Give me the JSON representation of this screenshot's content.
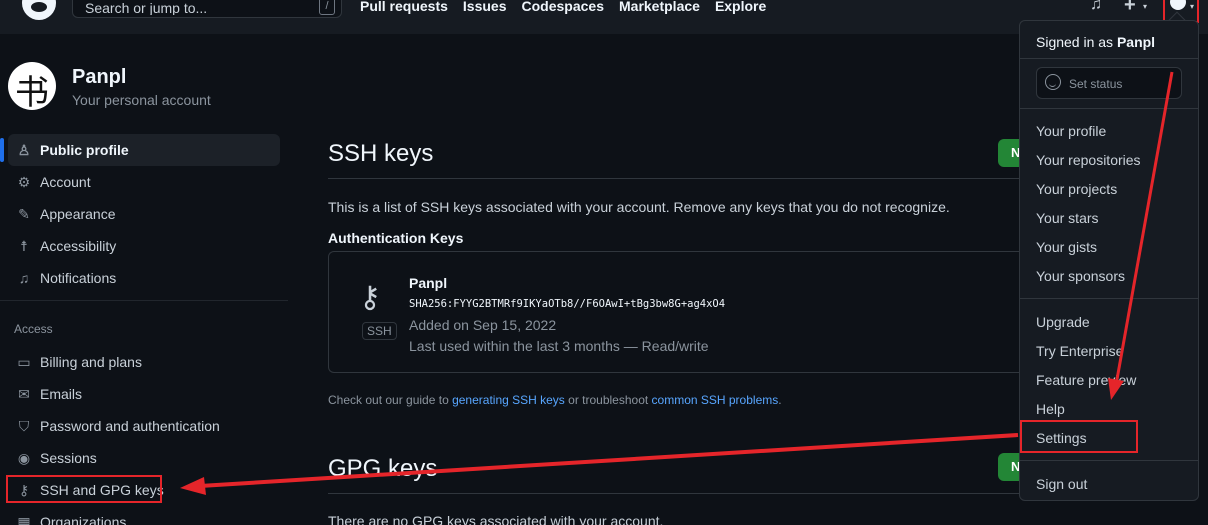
{
  "header": {
    "search_placeholder": "Search or jump to...",
    "search_key": "/",
    "nav": [
      "Pull requests",
      "Issues",
      "Codespaces",
      "Marketplace",
      "Explore"
    ],
    "plus": "+",
    "caret": "▾"
  },
  "profile": {
    "name": "Panpl",
    "subtitle": "Your personal account",
    "avatar_glyph": "书"
  },
  "sidebar": {
    "items": [
      {
        "label": "Public profile",
        "icon": "person-icon",
        "glyph": "♙",
        "active": true
      },
      {
        "label": "Account",
        "icon": "gear-icon",
        "glyph": "⚙"
      },
      {
        "label": "Appearance",
        "icon": "paintbrush-icon",
        "glyph": "✎"
      },
      {
        "label": "Accessibility",
        "icon": "accessibility-icon",
        "glyph": "☨"
      },
      {
        "label": "Notifications",
        "icon": "bell-icon",
        "glyph": "♫"
      }
    ],
    "access_heading": "Access",
    "access_items": [
      {
        "label": "Billing and plans",
        "icon": "credit-card-icon",
        "glyph": "▭"
      },
      {
        "label": "Emails",
        "icon": "mail-icon",
        "glyph": "✉"
      },
      {
        "label": "Password and authentication",
        "icon": "shield-lock-icon",
        "glyph": "⛉"
      },
      {
        "label": "Sessions",
        "icon": "broadcast-icon",
        "glyph": "◉"
      },
      {
        "label": "SSH and GPG keys",
        "icon": "key-icon",
        "glyph": "⚷"
      },
      {
        "label": "Organizations",
        "icon": "table-icon",
        "glyph": "▦"
      }
    ]
  },
  "main": {
    "title": "SSH keys",
    "new_button": "N",
    "description": "This is a list of SSH keys associated with your account. Remove any keys that you do not recognize.",
    "auth_heading": "Authentication Keys",
    "key": {
      "name": "Panpl",
      "fingerprint": "SHA256:FYYG2BTMRf9IKYaOTb8//F6OAwI+tBg3bw8G+ag4xO4",
      "badge": "SSH",
      "added": "Added on Sep 15, 2022",
      "last_used": "Last used within the last 3 months — Read/write"
    },
    "guide": {
      "prefix": "Check out our guide to ",
      "link1": "generating SSH keys",
      "middle": " or troubleshoot ",
      "link2": "common SSH problems",
      "suffix": "."
    },
    "gpg_title": "GPG keys",
    "gpg_button": "N",
    "gpg_empty": "There are no GPG keys associated with your account."
  },
  "dropdown": {
    "signed_prefix": "Signed in as ",
    "username": "Panpl",
    "set_status": "Set status",
    "group1": [
      "Your profile",
      "Your repositories",
      "Your projects",
      "Your stars",
      "Your gists",
      "Your sponsors"
    ],
    "group2": [
      "Upgrade",
      "Try Enterprise",
      "Feature preview",
      "Help",
      "Settings"
    ],
    "sign_out": "Sign out"
  },
  "colors": {
    "annotation_red": "#e5252a",
    "accent_blue": "#1f6feb",
    "link_blue": "#58a6ff",
    "button_green": "#238636"
  }
}
